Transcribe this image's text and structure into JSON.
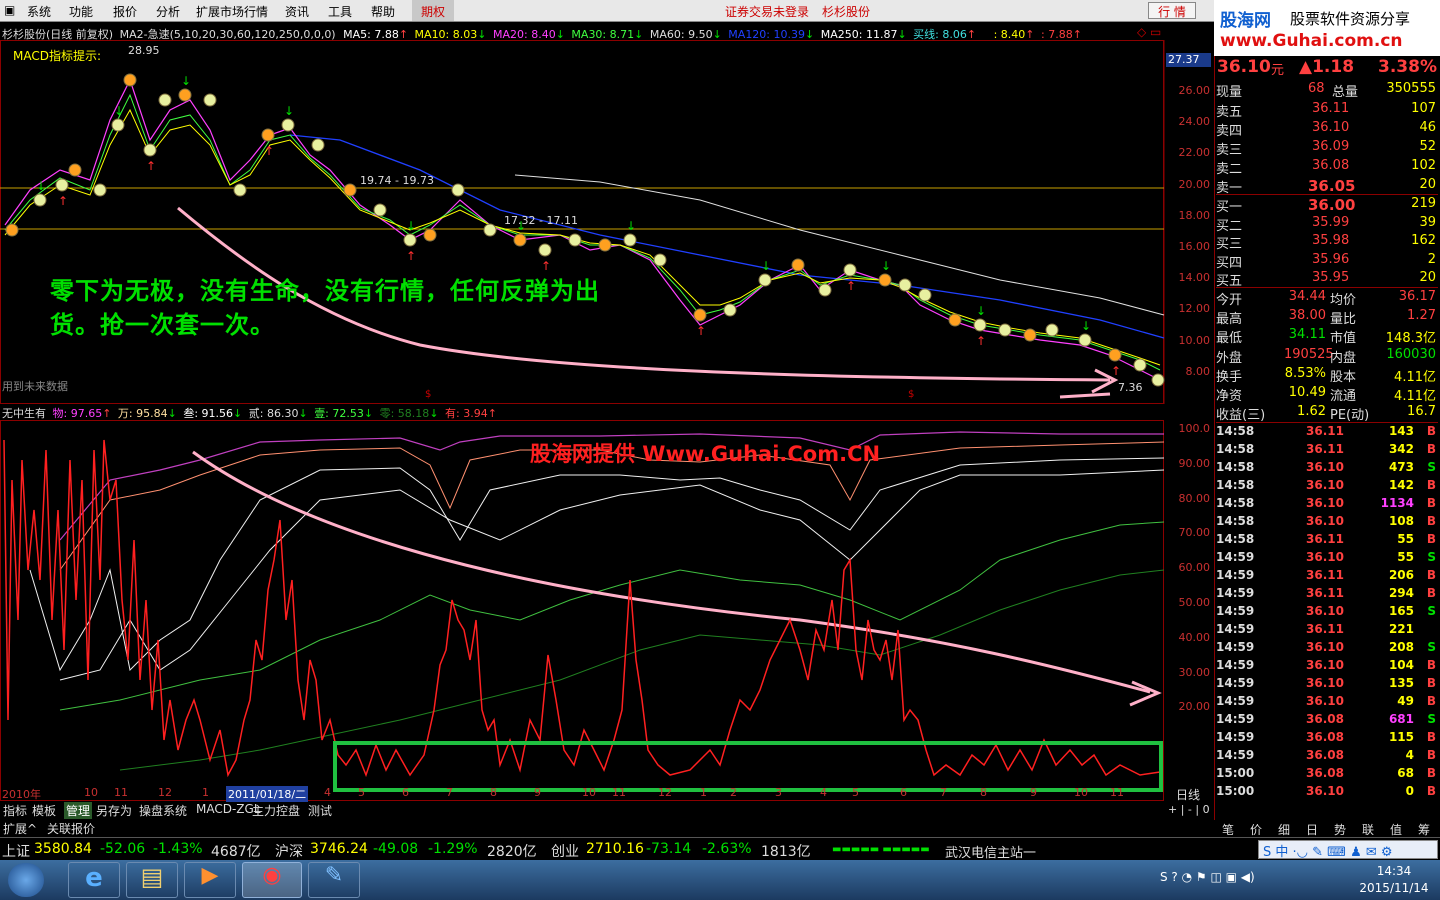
{
  "menu": {
    "items": [
      "系统",
      "功能",
      "报价",
      "分析",
      "扩展市场行情",
      "资讯",
      "工具",
      "帮助"
    ],
    "active": "期权",
    "status": "证券交易未登录",
    "stock": "杉杉股份",
    "quote_btn": "行 情",
    "brand1": "股海网",
    "brand2": "股票软件资源分享",
    "brand3": "www.Guhai.com.cn"
  },
  "main_chart": {
    "header": {
      "title": "杉杉股份(日线 前复权)",
      "ma_param": "MA2-急速(5,10,20,30,60,120,250,0,0,0)",
      "ma5": "MA5: 7.88",
      "ma10": "MA10: 8.03",
      "ma20": "MA20: 8.40",
      "ma30": "MA30: 8.71",
      "ma60": "MA60: 9.50",
      "ma120": "MA120: 10.39",
      "ma250": "MA250: 11.87",
      "buy": "买线: 8.06",
      "v1": ": 8.40",
      "v2": ": 7.88"
    },
    "macd_hint": "MACD指标提示:",
    "hi_label": "28.95",
    "range1": "19.74 - 19.73",
    "range2": "17.32 - 17.11",
    "lo_label": "7.36",
    "note1": "零下为无极，没有生命，没有行情，任何反弹为出",
    "note2": "货。抢一次套一次。",
    "note_future": "用到未来数据",
    "price_tag": "27.37",
    "y_ticks": [
      "26.00",
      "24.00",
      "22.00",
      "20.00",
      "18.00",
      "16.00",
      "14.00",
      "12.00",
      "10.00",
      "8.00"
    ]
  },
  "sub_chart": {
    "header": {
      "title": "无中生有",
      "wu": "物: 97.65",
      "wan": "万: 95.84",
      "san": "叁: 91.56",
      "er": "贰: 86.30",
      "yi": "壹: 72.53",
      "ling": "零: 58.18",
      "you": "有: 3.94"
    },
    "watermark": "股海网提供 Www.Guhai.Com.CN",
    "y_ticks": [
      "100.0",
      "90.00",
      "80.00",
      "70.00",
      "60.00",
      "50.00",
      "40.00",
      "30.00",
      "20.00"
    ],
    "x_labels": [
      "2010年",
      "10",
      "11",
      "12",
      "1",
      "2011/01/18/二",
      "4",
      "5",
      "6",
      "7",
      "8",
      "9",
      "10",
      "11",
      "12",
      "1",
      "2",
      "3",
      "4",
      "5",
      "6",
      "7",
      "8",
      "9",
      "10",
      "11"
    ],
    "period": "日线"
  },
  "tabs": [
    "指标",
    "模板",
    "管理",
    "另存为",
    "操盘系统",
    "MACD-ZGL",
    "主力控盘",
    "测试"
  ],
  "tabs2": [
    "扩展^",
    "关联报价"
  ],
  "quote": {
    "price": "36.10",
    "unit": "元",
    "change": "▲1.18",
    "pct": "3.38%",
    "now_label": "现量",
    "now": "68",
    "total_label": "总量",
    "total": "350555",
    "asks": [
      {
        "l": "卖五",
        "p": "36.11",
        "v": "107"
      },
      {
        "l": "卖四",
        "p": "36.10",
        "v": "46"
      },
      {
        "l": "卖三",
        "p": "36.09",
        "v": "52"
      },
      {
        "l": "卖二",
        "p": "36.08",
        "v": "102"
      },
      {
        "l": "卖一",
        "p": "36.05",
        "v": "20"
      }
    ],
    "bids": [
      {
        "l": "买一",
        "p": "36.00",
        "v": "219"
      },
      {
        "l": "买二",
        "p": "35.99",
        "v": "39"
      },
      {
        "l": "买三",
        "p": "35.98",
        "v": "162"
      },
      {
        "l": "买四",
        "p": "35.96",
        "v": "2"
      },
      {
        "l": "买五",
        "p": "35.95",
        "v": "20"
      }
    ],
    "stats": [
      [
        "今开",
        "34.44",
        "均价",
        "36.17"
      ],
      [
        "最高",
        "38.00",
        "量比",
        "1.27"
      ],
      [
        "最低",
        "34.11",
        "市值",
        "148.3亿"
      ],
      [
        "外盘",
        "190525",
        "内盘",
        "160030"
      ],
      [
        "换手",
        "8.53%",
        "股本",
        "4.11亿"
      ],
      [
        "净资",
        "10.49",
        "流通",
        "4.11亿"
      ],
      [
        "收益(三)",
        "1.62",
        "PE(动)",
        "16.7"
      ]
    ],
    "ticks": [
      [
        "14:58",
        "36.11",
        "143",
        "B"
      ],
      [
        "14:58",
        "36.11",
        "342",
        "B"
      ],
      [
        "14:58",
        "36.10",
        "473",
        "S"
      ],
      [
        "14:58",
        "36.10",
        "142",
        "B"
      ],
      [
        "14:58",
        "36.10",
        "1134",
        "B"
      ],
      [
        "14:58",
        "36.10",
        "108",
        "B"
      ],
      [
        "14:58",
        "36.11",
        "55",
        "B"
      ],
      [
        "14:59",
        "36.10",
        "55",
        "S"
      ],
      [
        "14:59",
        "36.11",
        "206",
        "B"
      ],
      [
        "14:59",
        "36.11",
        "294",
        "B"
      ],
      [
        "14:59",
        "36.10",
        "165",
        "S"
      ],
      [
        "14:59",
        "36.11",
        "221",
        ""
      ],
      [
        "14:59",
        "36.10",
        "208",
        "S"
      ],
      [
        "14:59",
        "36.10",
        "104",
        "B"
      ],
      [
        "14:59",
        "36.10",
        "135",
        "B"
      ],
      [
        "14:59",
        "36.10",
        "49",
        "B"
      ],
      [
        "14:59",
        "36.08",
        "681",
        "S"
      ],
      [
        "14:59",
        "36.08",
        "115",
        "B"
      ],
      [
        "14:59",
        "36.08",
        "4",
        "B"
      ],
      [
        "15:00",
        "36.08",
        "68",
        "B"
      ],
      [
        "15:00",
        "36.10",
        "0",
        "B"
      ]
    ],
    "bottom_tabs": [
      "笔",
      "价",
      "细",
      "日",
      "势",
      "联",
      "值",
      "筹"
    ]
  },
  "status": {
    "sh_label": "上证",
    "sh": "3580.84",
    "sh_ch": "-52.06",
    "sh_pct": "-1.43%",
    "sh_amt": "4687亿",
    "sz_label": "沪深",
    "sz": "3746.24",
    "sz_ch": "-49.08",
    "sz_pct": "-1.29%",
    "sz_amt": "2820亿",
    "cy_label": "创业",
    "cy": "2710.16",
    "cy_ch": "-73.14",
    "cy_pct": "-2.63%",
    "cy_amt": "1813亿",
    "server": "武汉电信主站一"
  },
  "taskbar": {
    "time": "14:34",
    "date": "2015/11/14",
    "ime": "中"
  },
  "colors": {
    "red": "#ff2020",
    "up": "#ff4040",
    "down": "#00e000",
    "yellow": "#ffff00",
    "grid": "#8b0000"
  }
}
